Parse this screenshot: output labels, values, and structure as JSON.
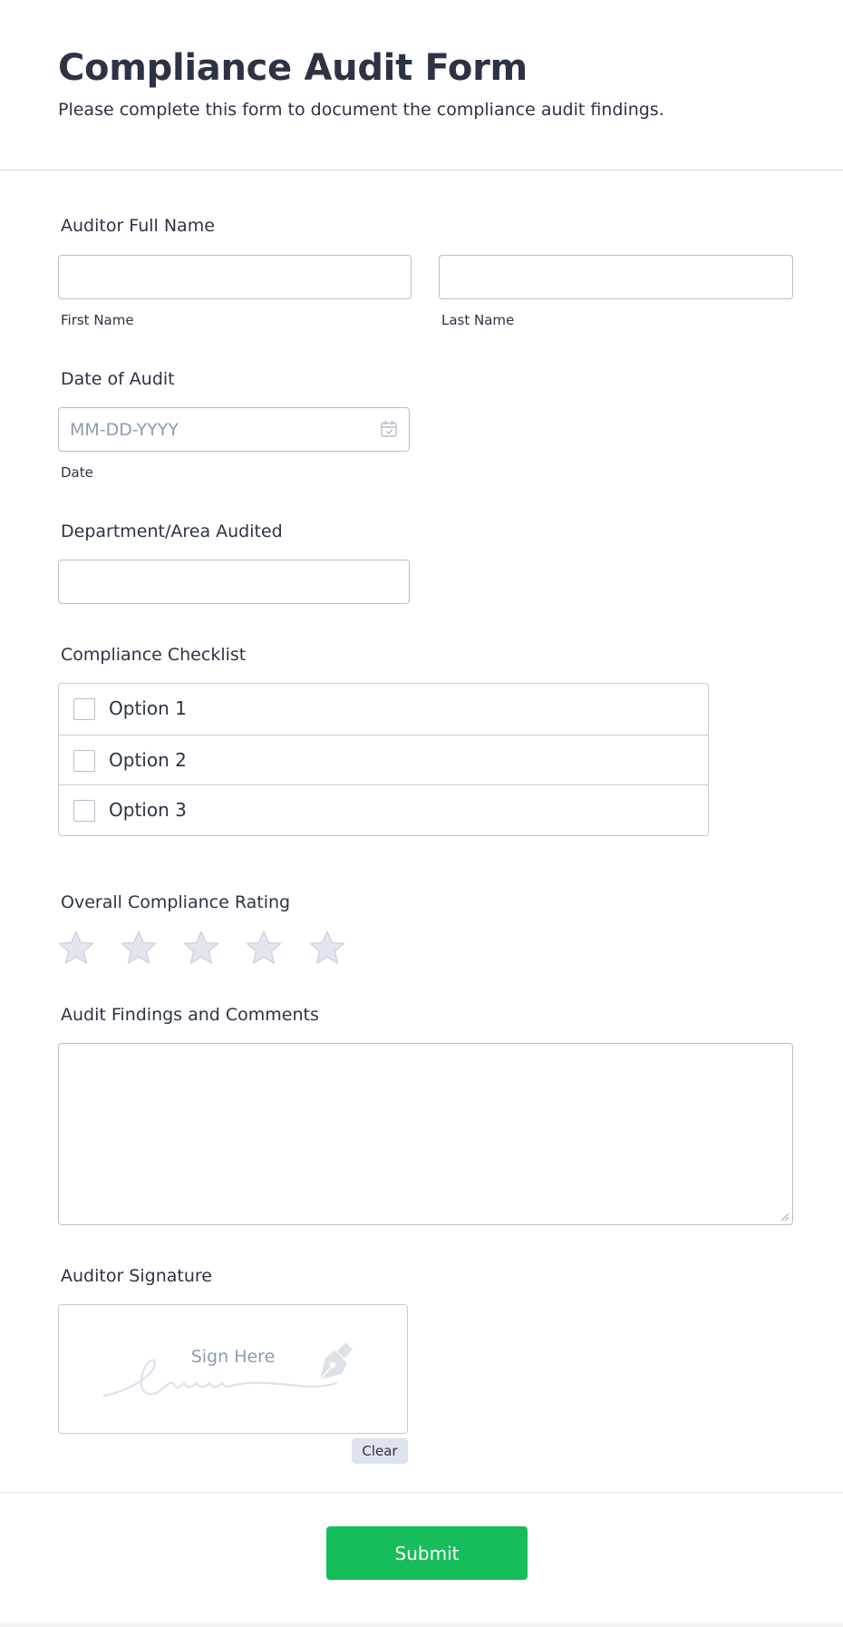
{
  "header": {
    "title": "Compliance Audit Form",
    "subtitle": "Please complete this form to document the compliance audit findings."
  },
  "auditor_name": {
    "label": "Auditor Full Name",
    "first_value": "",
    "last_value": "",
    "first_sublabel": "First Name",
    "last_sublabel": "Last Name"
  },
  "audit_date": {
    "label": "Date of Audit",
    "value": "",
    "placeholder": "MM-DD-YYYY",
    "sublabel": "Date",
    "icon": "calendar-icon"
  },
  "department": {
    "label": "Department/Area Audited",
    "value": ""
  },
  "checklist": {
    "label": "Compliance Checklist",
    "options": [
      "Option 1",
      "Option 2",
      "Option 3"
    ]
  },
  "rating": {
    "label": "Overall Compliance Rating",
    "max": 5,
    "value": 0,
    "icon": "star-icon"
  },
  "findings": {
    "label": "Audit Findings and Comments",
    "value": ""
  },
  "signature": {
    "label": "Auditor Signature",
    "placeholder": "Sign Here",
    "icon": "pen-nib-icon",
    "clear_label": "Clear"
  },
  "submit_label": "Submit",
  "colors": {
    "text": "#2c3345",
    "placeholder": "#8d9bb1",
    "border": "#b8bdc9",
    "star": "#e3e6ef",
    "star_outline": "#c8cedc",
    "submit": "#18bd5b",
    "clear_bg": "#dfe3f0"
  }
}
